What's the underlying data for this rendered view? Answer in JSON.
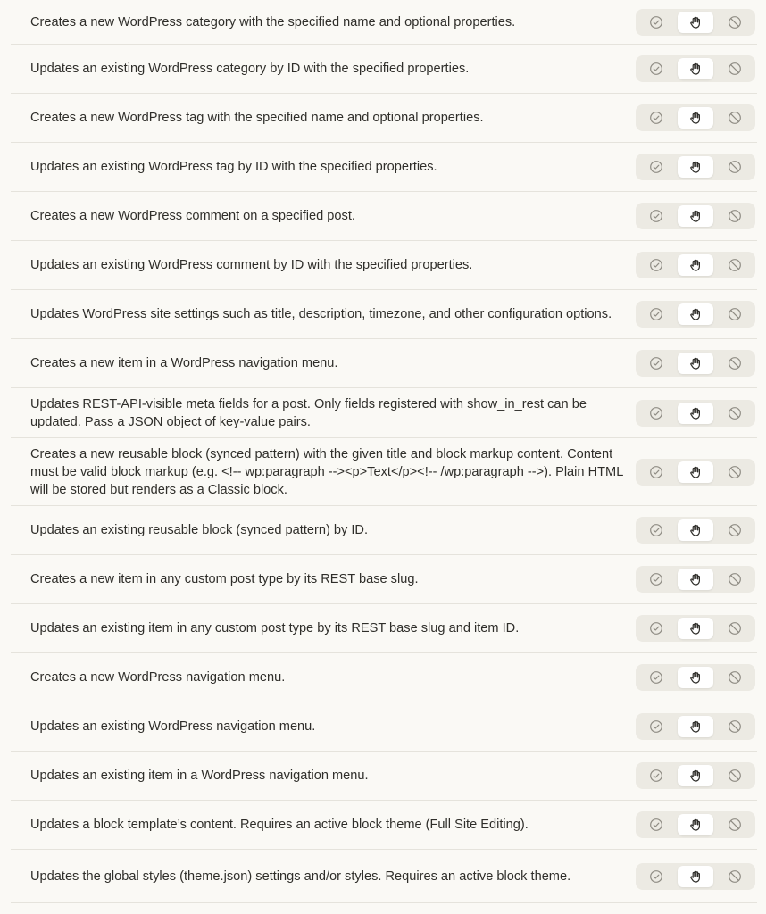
{
  "colors": {
    "background": "#faf9f5",
    "row_divider": "#e5e3dc",
    "segment_background": "#eceae3",
    "segment_active": "#ffffff",
    "icon_muted": "#8f8c84",
    "icon_active": "#2d2c28"
  },
  "permission_options": [
    {
      "icon": "check-circle-icon",
      "meaning": "allow"
    },
    {
      "icon": "hand-icon",
      "meaning": "ask"
    },
    {
      "icon": "block-icon",
      "meaning": "deny"
    }
  ],
  "tools": [
    {
      "description": "Creates a new WordPress category with the specified name and optional properties.",
      "selected": "ask"
    },
    {
      "description": "Updates an existing WordPress category by ID with the specified properties.",
      "selected": "ask"
    },
    {
      "description": "Creates a new WordPress tag with the specified name and optional properties.",
      "selected": "ask"
    },
    {
      "description": "Updates an existing WordPress tag by ID with the specified properties.",
      "selected": "ask"
    },
    {
      "description": "Creates a new WordPress comment on a specified post.",
      "selected": "ask"
    },
    {
      "description": "Updates an existing WordPress comment by ID with the specified properties.",
      "selected": "ask"
    },
    {
      "description": "Updates WordPress site settings such as title, description, timezone, and other configuration options.",
      "selected": "ask"
    },
    {
      "description": "Creates a new item in a WordPress navigation menu.",
      "selected": "ask"
    },
    {
      "description": "Updates REST-API-visible meta fields for a post. Only fields registered with show_in_rest can be updated. Pass a JSON object of key-value pairs.",
      "selected": "ask"
    },
    {
      "description": "Creates a new reusable block (synced pattern) with the given title and block markup content. Content must be valid block markup (e.g. <!-- wp:paragraph --><p>Text</p><!-- /wp:paragraph -->). Plain HTML will be stored but renders as a Classic block.",
      "selected": "ask"
    },
    {
      "description": "Updates an existing reusable block (synced pattern) by ID.",
      "selected": "ask"
    },
    {
      "description": "Creates a new item in any custom post type by its REST base slug.",
      "selected": "ask"
    },
    {
      "description": "Updates an existing item in any custom post type by its REST base slug and item ID.",
      "selected": "ask"
    },
    {
      "description": "Creates a new WordPress navigation menu.",
      "selected": "ask"
    },
    {
      "description": "Updates an existing WordPress navigation menu.",
      "selected": "ask"
    },
    {
      "description": "Updates an existing item in a WordPress navigation menu.",
      "selected": "ask"
    },
    {
      "description": "Updates a block template’s content. Requires an active block theme (Full Site Editing).",
      "selected": "ask"
    },
    {
      "description": "Updates the global styles (theme.json) settings and/or styles. Requires an active block theme.",
      "selected": "ask"
    }
  ]
}
